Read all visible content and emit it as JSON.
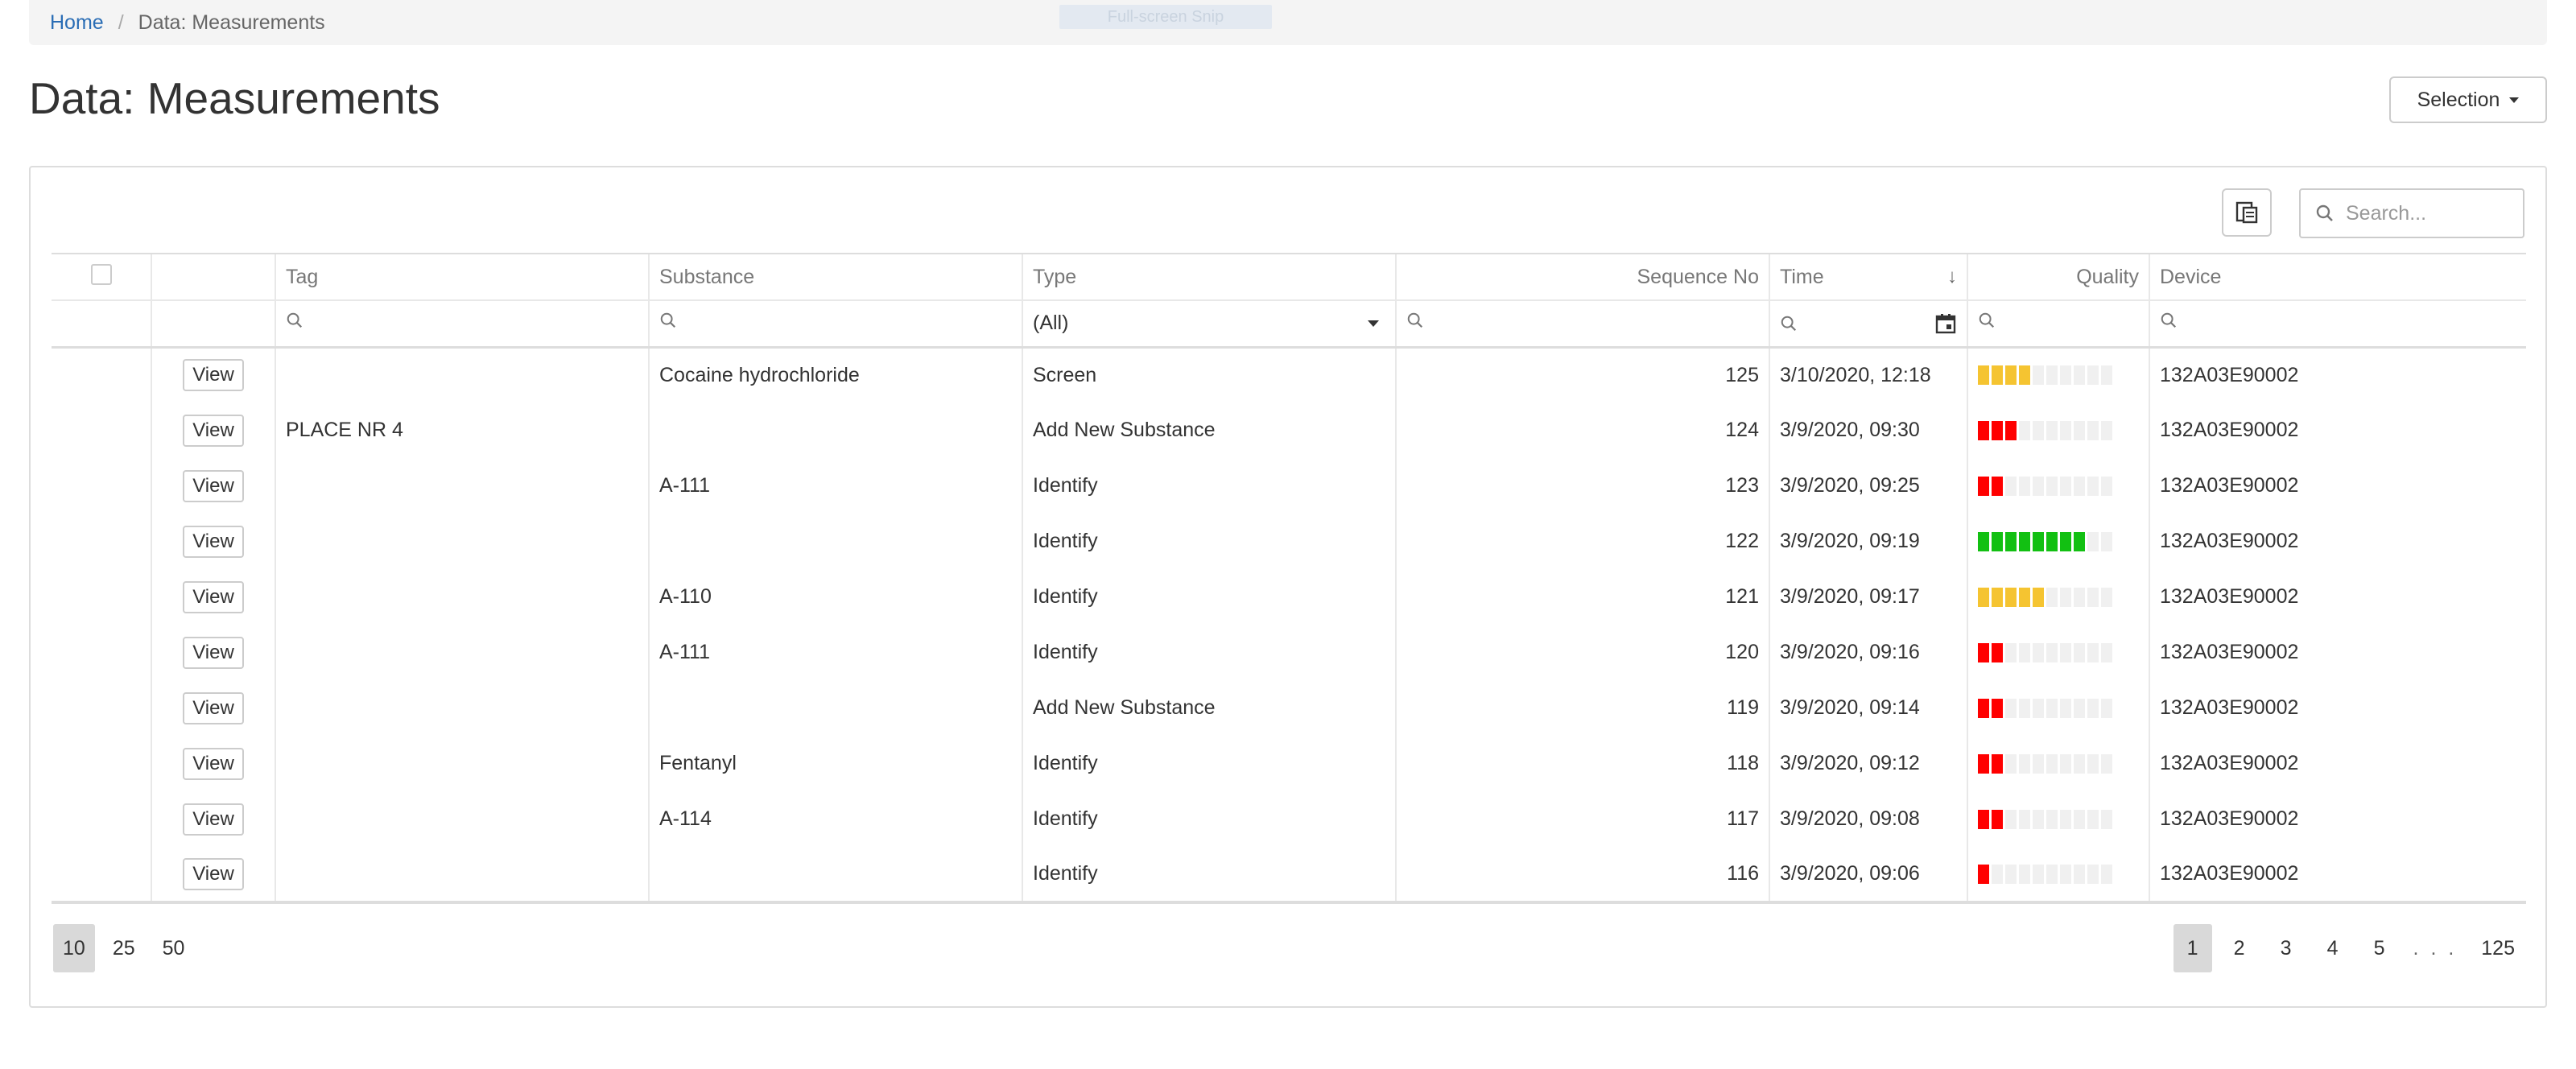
{
  "breadcrumb": {
    "home": "Home",
    "separator": "/",
    "current": "Data: Measurements"
  },
  "overlay": {
    "label": "Full-screen Snip"
  },
  "page": {
    "title": "Data: Measurements",
    "selection_label": "Selection"
  },
  "toolbar": {
    "column_chooser_icon": "column-chooser-icon",
    "search_placeholder": "Search..."
  },
  "columns": {
    "tag": "Tag",
    "substance": "Substance",
    "type": "Type",
    "sequence_no": "Sequence No",
    "time": "Time",
    "quality": "Quality",
    "device": "Device"
  },
  "filters": {
    "type_value": "(All)"
  },
  "colors": {
    "red": "#ff0000",
    "yellow": "#f5c431",
    "green": "#12c012",
    "empty": "#f0f0f0"
  },
  "rows": [
    {
      "view": "View",
      "tag": "",
      "substance": "Cocaine hydrochloride",
      "type": "Screen",
      "seq": "125",
      "time": "3/10/2020, 12:18",
      "quality_level": 4,
      "quality_color": "yellow",
      "device": "132A03E90002"
    },
    {
      "view": "View",
      "tag": "PLACE NR 4",
      "substance": "",
      "type": "Add New Substance",
      "seq": "124",
      "time": "3/9/2020, 09:30",
      "quality_level": 3,
      "quality_color": "red",
      "device": "132A03E90002"
    },
    {
      "view": "View",
      "tag": "",
      "substance": "A-111",
      "type": "Identify",
      "seq": "123",
      "time": "3/9/2020, 09:25",
      "quality_level": 2,
      "quality_color": "red",
      "device": "132A03E90002"
    },
    {
      "view": "View",
      "tag": "",
      "substance": "",
      "type": "Identify",
      "seq": "122",
      "time": "3/9/2020, 09:19",
      "quality_level": 8,
      "quality_color": "green",
      "device": "132A03E90002"
    },
    {
      "view": "View",
      "tag": "",
      "substance": "A-110",
      "type": "Identify",
      "seq": "121",
      "time": "3/9/2020, 09:17",
      "quality_level": 5,
      "quality_color": "yellow",
      "device": "132A03E90002"
    },
    {
      "view": "View",
      "tag": "",
      "substance": "A-111",
      "type": "Identify",
      "seq": "120",
      "time": "3/9/2020, 09:16",
      "quality_level": 2,
      "quality_color": "red",
      "device": "132A03E90002"
    },
    {
      "view": "View",
      "tag": "",
      "substance": "",
      "type": "Add New Substance",
      "seq": "119",
      "time": "3/9/2020, 09:14",
      "quality_level": 2,
      "quality_color": "red",
      "device": "132A03E90002"
    },
    {
      "view": "View",
      "tag": "",
      "substance": "Fentanyl",
      "type": "Identify",
      "seq": "118",
      "time": "3/9/2020, 09:12",
      "quality_level": 2,
      "quality_color": "red",
      "device": "132A03E90002"
    },
    {
      "view": "View",
      "tag": "",
      "substance": "A-114",
      "type": "Identify",
      "seq": "117",
      "time": "3/9/2020, 09:08",
      "quality_level": 2,
      "quality_color": "red",
      "device": "132A03E90002"
    },
    {
      "view": "View",
      "tag": "",
      "substance": "",
      "type": "Identify",
      "seq": "116",
      "time": "3/9/2020, 09:06",
      "quality_level": 1,
      "quality_color": "red",
      "device": "132A03E90002"
    }
  ],
  "pager": {
    "page_sizes": [
      "10",
      "25",
      "50"
    ],
    "page_size_active": "10",
    "pages": [
      "1",
      "2",
      "3",
      "4",
      "5"
    ],
    "ellipsis": ". . .",
    "last_page": "125",
    "current_page": "1"
  }
}
